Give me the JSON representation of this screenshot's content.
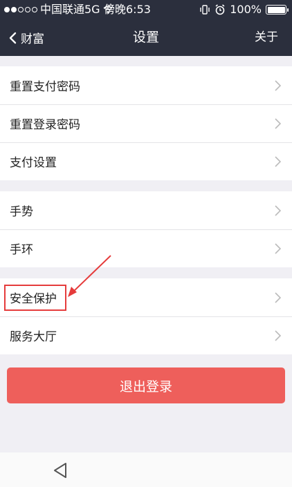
{
  "status_bar": {
    "carrier": "中国联通5G",
    "time": "傍晚6:53",
    "battery": "100%",
    "signal_strength": 0.4
  },
  "navbar": {
    "back_label": "财富",
    "title": "设置",
    "about_label": "关于"
  },
  "groups": [
    {
      "items": [
        "重置支付密码",
        "重置登录密码",
        "支付设置"
      ]
    },
    {
      "items": [
        "手势",
        "手环"
      ]
    },
    {
      "items": [
        "安全保护",
        "服务大厅"
      ]
    }
  ],
  "logout_label": "退出登录",
  "colors": {
    "header_bg": "#2b2f3d",
    "logout_bg": "#ee5f5b",
    "highlight": "#e53b3b"
  }
}
